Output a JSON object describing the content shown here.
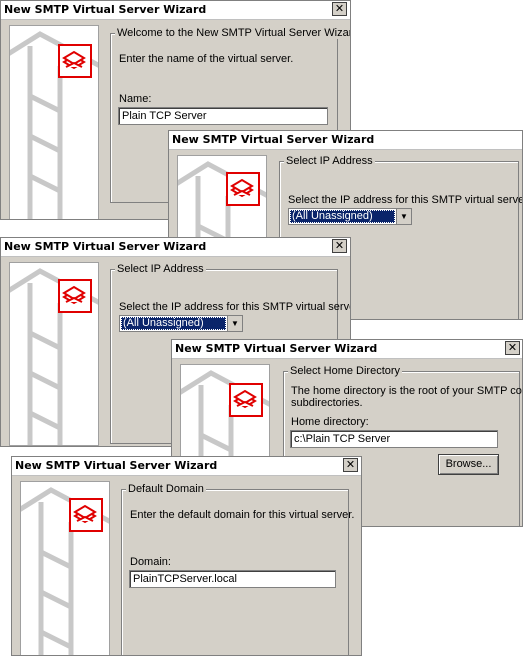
{
  "dialogs": [
    {
      "title": "New SMTP Virtual Server Wizard",
      "section": "Welcome to the New SMTP Virtual Server Wizard",
      "instruction": "Enter the name of the virtual server.",
      "field_label": "Name:",
      "field_value": "Plain TCP Server"
    },
    {
      "title": "New SMTP Virtual Server Wizard",
      "section": "Select IP Address",
      "instruction": "Select the IP address for this SMTP virtual server",
      "select_value": "(All Unassigned)"
    },
    {
      "title": "New SMTP Virtual Server Wizard",
      "section": "Select IP Address",
      "instruction": "Select the IP address for this SMTP virtual server",
      "select_value": "(All Unassigned)"
    },
    {
      "title": "New SMTP Virtual Server Wizard",
      "section": "Select Home Directory",
      "description_line1": "The home directory is the root of your SMTP content",
      "description_line2": "subdirectories.",
      "field_label": "Home directory:",
      "field_value": "c:\\Plain TCP Server",
      "browse_label": "Browse..."
    },
    {
      "title": "New SMTP Virtual Server Wizard",
      "section": "Default Domain",
      "instruction": "Enter the default domain for this virtual server.",
      "field_label": "Domain:",
      "field_value": "PlainTCPServer.local"
    }
  ],
  "icons": {
    "close": "close-icon",
    "dropdown": "chevron-down-icon",
    "logo": "smtp-mail-logo-icon"
  },
  "colors": {
    "logo_border": "#e00000",
    "selection": "#0a246a",
    "dialog_bg": "#d4d0c8"
  }
}
